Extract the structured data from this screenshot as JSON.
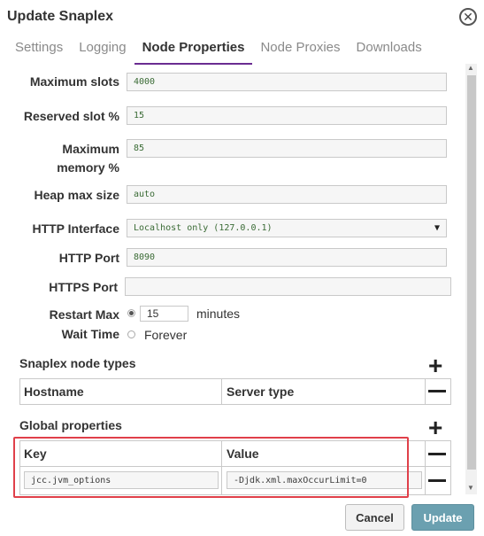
{
  "dialog": {
    "title": "Update Snaplex"
  },
  "tabs": [
    {
      "label": "Settings",
      "active": false
    },
    {
      "label": "Logging",
      "active": false
    },
    {
      "label": "Node Properties",
      "active": true
    },
    {
      "label": "Node Proxies",
      "active": false
    },
    {
      "label": "Downloads",
      "active": false
    }
  ],
  "fields": {
    "max_slots": {
      "label": "Maximum slots",
      "value": "4000"
    },
    "reserved_slot": {
      "label": "Reserved slot %",
      "value": "15"
    },
    "max_memory": {
      "label_line1": "Maximum",
      "label_line2": "memory %",
      "value": "85"
    },
    "heap_max": {
      "label": "Heap max size",
      "value": "auto"
    },
    "http_interface": {
      "label": "HTTP Interface",
      "value": "Localhost only (127.0.0.1)"
    },
    "http_port": {
      "label": "HTTP Port",
      "value": "8090"
    },
    "https_port": {
      "label": "HTTPS Port",
      "value": ""
    },
    "restart": {
      "label_line1": "Restart Max",
      "label_line2": "Wait Time",
      "minutes_value": "15",
      "minutes_label": "minutes",
      "forever_label": "Forever",
      "selected": "minutes"
    }
  },
  "node_types": {
    "title": "Snaplex node types",
    "columns": [
      "Hostname",
      "Server type"
    ]
  },
  "global_properties": {
    "title": "Global properties",
    "columns": [
      "Key",
      "Value"
    ],
    "rows": [
      {
        "key": "jcc.jvm_options",
        "value": "-Djdk.xml.maxOccurLimit=0"
      }
    ]
  },
  "buttons": {
    "cancel": "Cancel",
    "update": "Update"
  },
  "colors": {
    "tab_underline": "#6a2c91",
    "update_button": "#6ba0b0",
    "highlight": "#e0404a"
  }
}
